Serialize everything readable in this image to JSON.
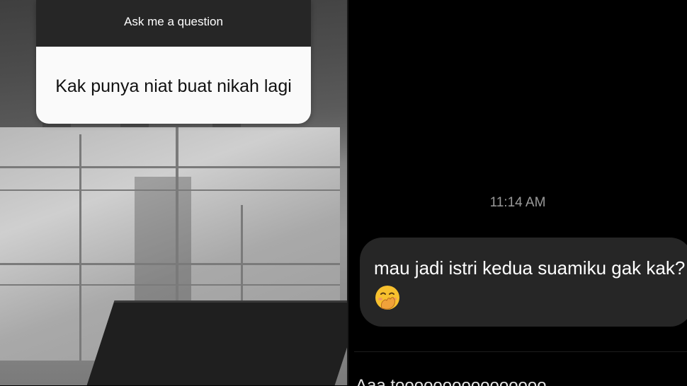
{
  "left_panel": {
    "question_sticker": {
      "header": "Ask me a question",
      "question": "Kak punya niat buat nikah lagi"
    }
  },
  "right_panel": {
    "timestamp": "11:14 AM",
    "message": {
      "text": "mau jadi istri kedua suamiku gak kak?",
      "emoji": "hand-over-mouth-emoji"
    },
    "cut_off_text": "Aaa toooooooooooooooo"
  },
  "colors": {
    "sticker_header": "#262626",
    "sticker_body": "#fafafa",
    "chat_bg": "#000000",
    "bubble_bg": "#262626",
    "timestamp": "#9a9a9a"
  }
}
